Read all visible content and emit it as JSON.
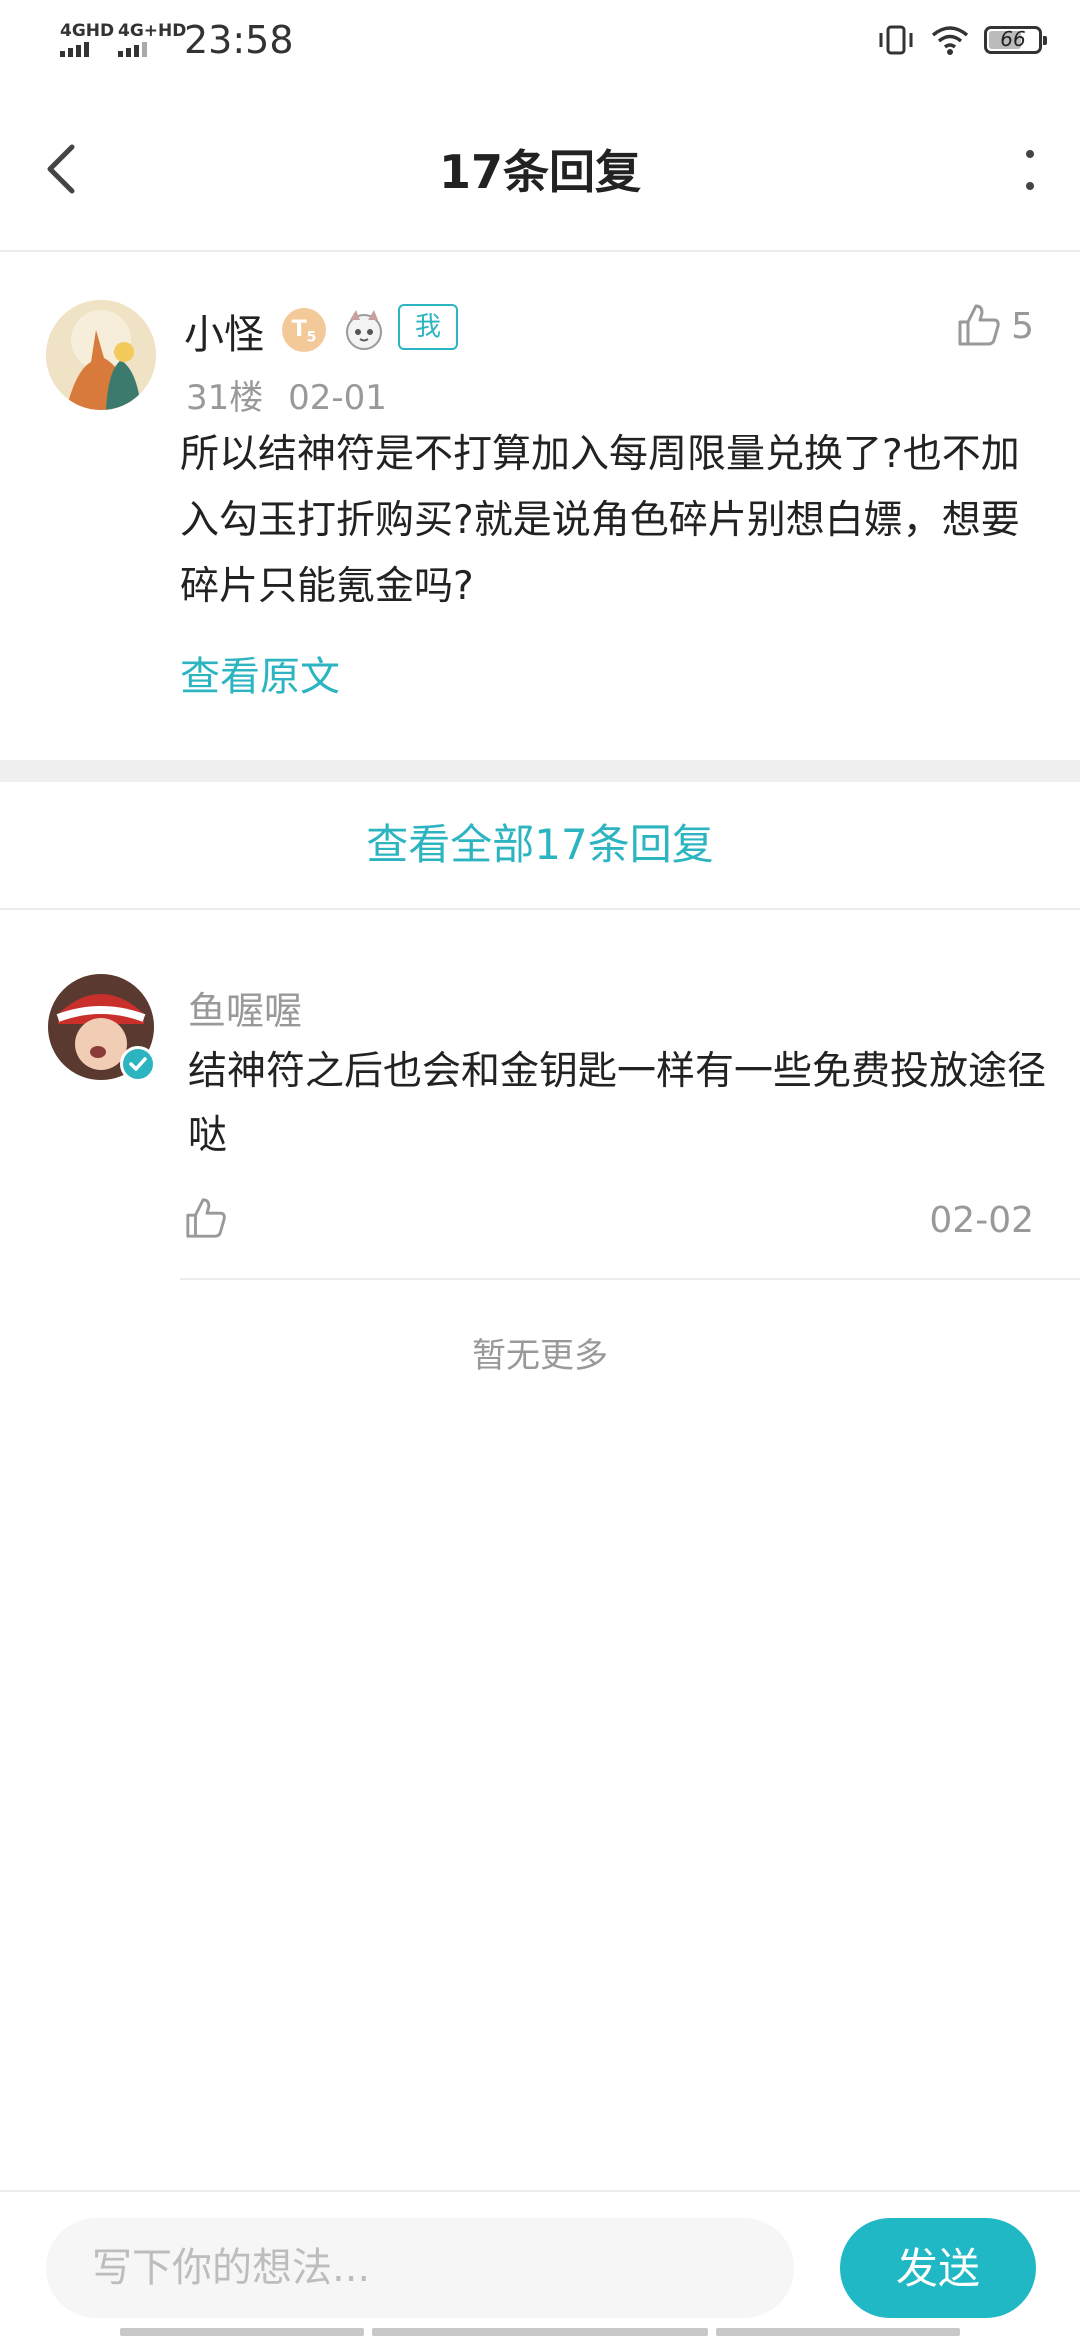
{
  "status_bar": {
    "network_1": "4GHD",
    "network_2": "4G+HD",
    "time": "23:58",
    "battery": "66",
    "battery_level": 0.66,
    "icons": [
      "vibrate-icon",
      "wifi-icon",
      "battery-icon"
    ]
  },
  "header": {
    "title": "17条回复",
    "back_icon": "chevron-left-icon",
    "more_icon": "more-vertical-icon"
  },
  "post": {
    "username": "小怪",
    "level_badge": "T",
    "level_sub": "5",
    "me_tag": "我",
    "like_count": "5",
    "floor": "31楼",
    "date": "02-01",
    "content": "所以结神符是不打算加入每周限量兑换了?也不加入勾玉打折购买?就是说角色碎片别想白嫖，想要碎片只能氪金吗?",
    "view_original": "查看原文"
  },
  "view_all_label": "查看全部17条回复",
  "reply": {
    "username": "鱼喔喔",
    "content": "结神符之后也会和金钥匙一样有一些免费投放途径哒",
    "date": "02-02"
  },
  "no_more_label": "暂无更多",
  "composer": {
    "placeholder": "写下你的想法...",
    "send_label": "发送"
  },
  "colors": {
    "accent": "#2cb5c0",
    "send_button": "#1fb8c4"
  }
}
